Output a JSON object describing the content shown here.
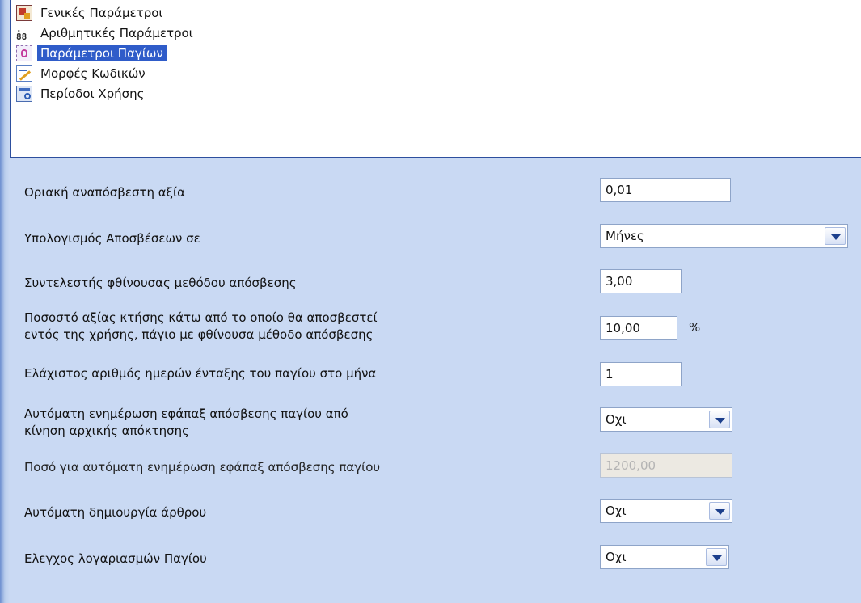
{
  "tree": {
    "items": [
      {
        "label": "Γενικές Παράμετροι",
        "icon": "general-settings-icon",
        "selected": false
      },
      {
        "label": "Αριθμητικές Παράμετροι",
        "icon": "numeric-parameters-icon",
        "selected": false
      },
      {
        "label": "Παράμετροι Παγίων",
        "icon": "fixed-assets-icon",
        "selected": true
      },
      {
        "label": "Μορφές Κωδικών",
        "icon": "code-formats-icon",
        "selected": false
      },
      {
        "label": "Περίοδοι Χρήσης",
        "icon": "fiscal-periods-icon",
        "selected": false
      }
    ]
  },
  "form": {
    "min_depreciable_value": {
      "label": "Οριακή αναπόσβεστη αξία",
      "value": "0,01"
    },
    "depreciation_calc": {
      "label": "Υπολογισμός Αποσβέσεων σε",
      "value": "Μήνες"
    },
    "declining_factor": {
      "label": "Συντελεστής φθίνουσας μεθόδου απόσβεσης",
      "value": "3,00"
    },
    "acquisition_pct": {
      "label_line1": "Ποσοστό αξίας κτήσης κάτω από το οποίο θα αποσβεστεί",
      "label_line2": "εντός της χρήσης, πάγιο με φθίνουσα μέθοδο απόσβεσης",
      "value": "10,00",
      "unit": "%"
    },
    "min_days": {
      "label": "Ελάχιστος αριθμός ημερών ένταξης του παγίου στο μήνα",
      "value": "1"
    },
    "auto_update_lump": {
      "label_line1": "Αυτόματη ενημέρωση εφάπαξ απόσβεσης παγίου από",
      "label_line2": "κίνηση αρχικής απόκτησης",
      "value": "Οχι"
    },
    "auto_update_amount": {
      "label": "Ποσό για αυτόματη ενημέρωση εφάπαξ απόσβεσης παγίου",
      "value": "1200,00",
      "disabled": true
    },
    "auto_create_entry": {
      "label": "Αυτόματη δημιουργία άρθρου",
      "value": "Οχι"
    },
    "asset_account_check": {
      "label": "Ελεγχος λογαριασμών Παγίου",
      "value": "Οχι"
    }
  },
  "colors": {
    "panel_bg": "#c9d9f3",
    "selection": "#2f5cc9",
    "border": "#2d4f9e"
  }
}
